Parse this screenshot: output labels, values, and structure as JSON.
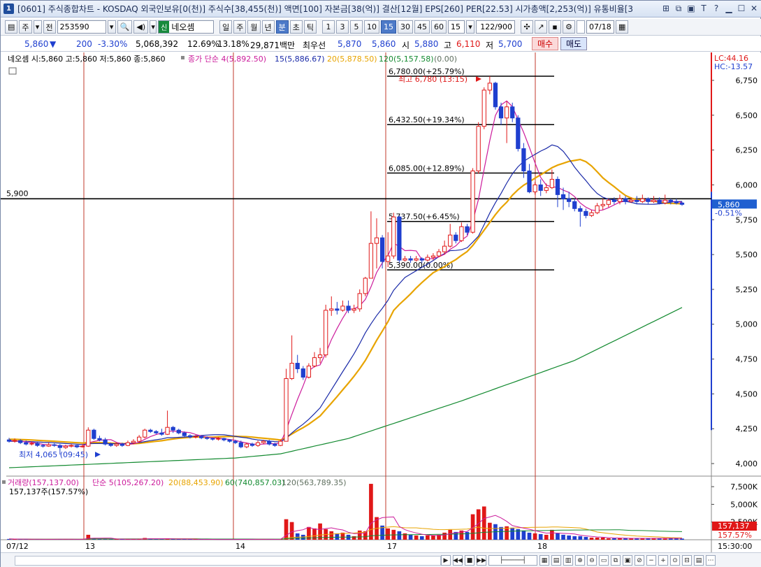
{
  "titlebar": {
    "number": "1",
    "text": "[0601] 주식종합차트 - KOSDAQ 외국인보유[0(천)] 주식수[38,455(천)] 액면[100] 자본금[38(억)] 결산[12월] EPS[260] PER[22.53] 시가총액[2,253(억)] 유통비율[3"
  },
  "toolbar": {
    "mode1": "주",
    "mode2": "전",
    "code": "253590",
    "stock_badge": "신",
    "stock_name": "네오셈",
    "period_buttons": [
      "일",
      "주",
      "월",
      "년",
      "분",
      "초",
      "틱"
    ],
    "period_selected": "분",
    "interval_buttons": [
      "1",
      "3",
      "5",
      "10",
      "15",
      "30",
      "45",
      "60"
    ],
    "interval_selected": "15",
    "interval_value": "15",
    "count": "122/900",
    "date": "07/18"
  },
  "quote": {
    "price": "5,860",
    "change": "200",
    "change_pct": "-3.30%",
    "volume": "5,068,392",
    "turnover": "12.69%",
    "ratio": "13.18%",
    "amount": "29,871백만",
    "best_label": "최우선",
    "ask": "5,870",
    "bid": "5,860",
    "open_label": "시",
    "open": "5,880",
    "high_label": "고",
    "high": "6,110",
    "low_label": "저",
    "low": "5,700",
    "buy_label": "매수",
    "sell_label": "매도"
  },
  "colors": {
    "up": "#e01818",
    "down": "#1f3fcf",
    "ma5": "#cc1c9c",
    "ma15": "#1a2aa8",
    "ma20": "#e8a400",
    "ma60": "#138a30",
    "ma120": "#5f6f5f",
    "day_line": "#c0392b"
  },
  "chart_data": [
    {
      "type": "candlestick",
      "legend_ohlc": "네오셈 시:5,860 고:5,860 저:5,860 종:5,860",
      "legend_ma": [
        {
          "name": "종가 단순 4(5,892.50)"
        },
        {
          "name": "15(5,886.67)"
        },
        {
          "name": "20(5,878.50)"
        },
        {
          "name": "120(5,157.58)"
        },
        {
          "name": "(0.00)"
        }
      ],
      "y_ticks": [
        "6,750",
        "6,500",
        "6,250",
        "6,000",
        "5,750",
        "5,500",
        "5,250",
        "5,000",
        "4,750",
        "4,500",
        "4,250",
        "4,000"
      ],
      "ylim": [
        3910,
        6840
      ],
      "x_labels": [
        "07/12",
        "13",
        "14",
        "17",
        "18"
      ],
      "day_boundaries": [
        119,
        333,
        551,
        765
      ],
      "hline_label": "5,900",
      "hline_value": 5900,
      "lc_label": "LC:44.16",
      "hc_label": "HC:-13.57",
      "last_price_label": "5,860",
      "last_pct_label": "-0.51%",
      "high_note": "최고 6,780 (13:15)",
      "low_note": "최저 4,065 (09:45)",
      "fib_levels": [
        {
          "value": 6780,
          "label": "6,780.00(+25.79%)"
        },
        {
          "value": 6432.5,
          "label": "6,432.50(+19.34%)"
        },
        {
          "value": 6085,
          "label": "6,085.00(+12.89%)"
        },
        {
          "value": 5737.5,
          "label": "5,737.50(+6.45%)"
        },
        {
          "value": 5390,
          "label": "5,390.00(0.00%)"
        }
      ],
      "candles": [
        [
          4170,
          4160,
          4185,
          4150
        ],
        [
          4160,
          4165,
          4180,
          4150
        ],
        [
          4165,
          4150,
          4175,
          4140
        ],
        [
          4150,
          4140,
          4165,
          4130
        ],
        [
          4140,
          4145,
          4160,
          4130
        ],
        [
          4145,
          4130,
          4155,
          4120
        ],
        [
          4130,
          4125,
          4140,
          4115
        ],
        [
          4125,
          4135,
          4150,
          4120
        ],
        [
          4135,
          4130,
          4145,
          4120
        ],
        [
          4130,
          4115,
          4140,
          4065
        ],
        [
          4115,
          4125,
          4135,
          4105
        ],
        [
          4125,
          4130,
          4140,
          4115
        ],
        [
          4130,
          4120,
          4135,
          4110
        ],
        [
          4120,
          4125,
          4140,
          4115
        ],
        [
          4125,
          4240,
          4260,
          4120
        ],
        [
          4240,
          4180,
          4250,
          4170
        ],
        [
          4180,
          4170,
          4200,
          4160
        ],
        [
          4170,
          4140,
          4185,
          4130
        ],
        [
          4140,
          4130,
          4150,
          4120
        ],
        [
          4130,
          4140,
          4150,
          4120
        ],
        [
          4140,
          4130,
          4150,
          4120
        ],
        [
          4130,
          4150,
          4165,
          4125
        ],
        [
          4150,
          4160,
          4175,
          4140
        ],
        [
          4160,
          4190,
          4205,
          4150
        ],
        [
          4190,
          4240,
          4250,
          4180
        ],
        [
          4240,
          4230,
          4250,
          4220
        ],
        [
          4230,
          4220,
          4240,
          4210
        ],
        [
          4220,
          4210,
          4250,
          4200
        ],
        [
          4210,
          4260,
          4380,
          4205
        ],
        [
          4260,
          4240,
          4270,
          4220
        ],
        [
          4240,
          4220,
          4250,
          4210
        ],
        [
          4220,
          4200,
          4230,
          4190
        ],
        [
          4200,
          4190,
          4210,
          4180
        ],
        [
          4190,
          4195,
          4205,
          4180
        ],
        [
          4195,
          4185,
          4200,
          4175
        ],
        [
          4185,
          4180,
          4195,
          4170
        ],
        [
          4180,
          4175,
          4185,
          4165
        ],
        [
          4175,
          4180,
          4190,
          4165
        ],
        [
          4180,
          4170,
          4185,
          4160
        ],
        [
          4170,
          4160,
          4175,
          4150
        ],
        [
          4160,
          4150,
          4170,
          4140
        ],
        [
          4150,
          4120,
          4165,
          4110
        ],
        [
          4120,
          4140,
          4150,
          4110
        ],
        [
          4140,
          4130,
          4150,
          4120
        ],
        [
          4130,
          4150,
          4165,
          4120
        ],
        [
          4150,
          4160,
          4170,
          4140
        ],
        [
          4160,
          4140,
          4170,
          4130
        ],
        [
          4140,
          4130,
          4150,
          4120
        ],
        [
          4130,
          4160,
          4170,
          4125
        ],
        [
          4160,
          4610,
          4680,
          4560
        ],
        [
          4610,
          4720,
          4920,
          4600
        ],
        [
          4720,
          4680,
          4780,
          4650
        ],
        [
          4680,
          4620,
          4700,
          4600
        ],
        [
          4620,
          4700,
          4720,
          4610
        ],
        [
          4700,
          4760,
          4800,
          4690
        ],
        [
          4760,
          4780,
          4830,
          4720
        ],
        [
          4780,
          5100,
          5140,
          4760
        ],
        [
          5100,
          5110,
          5200,
          5060
        ],
        [
          5110,
          5100,
          5160,
          5070
        ],
        [
          5100,
          5130,
          5170,
          5090
        ],
        [
          5130,
          5100,
          5170,
          5080
        ],
        [
          5100,
          5110,
          5140,
          5080
        ],
        [
          5110,
          5220,
          5250,
          5090
        ],
        [
          5220,
          5330,
          5340,
          5200
        ],
        [
          5330,
          5580,
          5810,
          5410
        ],
        [
          5580,
          5620,
          5760,
          5400
        ],
        [
          5620,
          5450,
          5640,
          5400
        ],
        [
          5450,
          5490,
          5660,
          5410
        ],
        [
          5490,
          5770,
          5800,
          5470
        ],
        [
          5770,
          5460,
          5780,
          5440
        ],
        [
          5460,
          5470,
          5490,
          5450
        ],
        [
          5470,
          5460,
          5490,
          5440
        ],
        [
          5460,
          5470,
          5490,
          5450
        ],
        [
          5470,
          5460,
          5480,
          5440
        ],
        [
          5460,
          5480,
          5500,
          5450
        ],
        [
          5480,
          5490,
          5510,
          5460
        ],
        [
          5490,
          5520,
          5540,
          5480
        ],
        [
          5520,
          5560,
          5600,
          5500
        ],
        [
          5560,
          5640,
          5720,
          5550
        ],
        [
          5640,
          5600,
          5660,
          5580
        ],
        [
          5600,
          5700,
          5730,
          5590
        ],
        [
          5700,
          5660,
          5720,
          5640
        ],
        [
          5660,
          6100,
          6120,
          5650
        ],
        [
          6100,
          6420,
          6450,
          6080
        ],
        [
          6420,
          6680,
          6700,
          6400
        ],
        [
          6680,
          6730,
          6780,
          6650
        ],
        [
          6730,
          6560,
          6740,
          6540
        ],
        [
          6560,
          6480,
          6590,
          6430
        ],
        [
          6480,
          6560,
          6600,
          6300
        ],
        [
          6560,
          6480,
          6590,
          6450
        ],
        [
          6480,
          6260,
          6500,
          6240
        ],
        [
          6260,
          6100,
          6300,
          6050
        ],
        [
          6100,
          5950,
          6150,
          5940
        ],
        [
          5950,
          6000,
          6020,
          5930
        ],
        [
          6000,
          5960,
          6040,
          5920
        ],
        [
          5960,
          5980,
          6010,
          5940
        ],
        [
          5980,
          6040,
          6110,
          5970
        ],
        [
          6040,
          5930,
          6060,
          5840
        ],
        [
          5930,
          5900,
          5980,
          5820
        ],
        [
          5900,
          5880,
          5950,
          5840
        ],
        [
          5880,
          5830,
          5900,
          5810
        ],
        [
          5830,
          5810,
          5850,
          5700
        ],
        [
          5810,
          5780,
          5830,
          5760
        ],
        [
          5780,
          5800,
          5820,
          5770
        ],
        [
          5800,
          5850,
          5870,
          5790
        ],
        [
          5850,
          5860,
          5900,
          5820
        ],
        [
          5860,
          5890,
          5900,
          5840
        ],
        [
          5890,
          5880,
          5910,
          5860
        ],
        [
          5880,
          5900,
          5930,
          5860
        ],
        [
          5900,
          5880,
          5920,
          5860
        ],
        [
          5880,
          5890,
          5910,
          5870
        ],
        [
          5890,
          5880,
          5920,
          5860
        ],
        [
          5880,
          5900,
          5930,
          5870
        ],
        [
          5900,
          5880,
          5910,
          5860
        ],
        [
          5880,
          5890,
          5920,
          5870
        ],
        [
          5890,
          5870,
          5910,
          5860
        ],
        [
          5870,
          5890,
          5930,
          5860
        ],
        [
          5890,
          5880,
          5900,
          5860
        ],
        [
          5880,
          5870,
          5900,
          5860
        ],
        [
          5870,
          5860,
          5880,
          5850
        ]
      ],
      "ma5_start": 4165,
      "ma15_start": 4160,
      "ma20_start": 4175,
      "ma60": [
        [
          0,
          3970
        ],
        [
          40,
          4040
        ],
        [
          48,
          4070
        ],
        [
          60,
          4180
        ],
        [
          80,
          4450
        ],
        [
          100,
          4740
        ],
        [
          121,
          5160
        ]
      ]
    },
    {
      "type": "bar",
      "title": "거래량(157,137.00)",
      "legend_ma": [
        {
          "name": "단순 5(105,267.20)"
        },
        {
          "name": "20(88,453.90)"
        },
        {
          "name": "60(740,857.03)"
        },
        {
          "name": "120(563,789.35)"
        }
      ],
      "sub_label": "157,137주(157.57%)",
      "y_ticks": [
        "7,500K",
        "5,000K",
        "2,500K"
      ],
      "ylim": [
        0,
        8300000
      ],
      "last_volume_label": "157,137",
      "last_pct_label": "157.57%",
      "time_label": "15:30:00",
      "volumes_k": [
        110,
        90,
        80,
        70,
        60,
        50,
        60,
        80,
        60,
        80,
        50,
        60,
        50,
        60,
        700,
        200,
        120,
        90,
        80,
        60,
        70,
        90,
        70,
        150,
        250,
        120,
        80,
        70,
        200,
        100,
        90,
        60,
        60,
        50,
        50,
        40,
        40,
        40,
        40,
        40,
        50,
        80,
        60,
        50,
        60,
        60,
        50,
        40,
        80,
        2900,
        2500,
        900,
        700,
        1800,
        1600,
        2300,
        1500,
        1200,
        900,
        1000,
        700,
        500,
        1300,
        1200,
        7900,
        3200,
        2000,
        1600,
        1400,
        1200,
        900,
        700,
        600,
        500,
        600,
        600,
        700,
        1000,
        1400,
        1100,
        1300,
        1100,
        3600,
        4300,
        4700,
        2400,
        2200,
        1800,
        1900,
        1700,
        1500,
        1300,
        1000,
        900,
        800,
        700,
        1400,
        900,
        700,
        600,
        500,
        500,
        400,
        300,
        300,
        300,
        200,
        200,
        200,
        200,
        200,
        200,
        200,
        200,
        200,
        200,
        200,
        200,
        200,
        160
      ]
    }
  ]
}
